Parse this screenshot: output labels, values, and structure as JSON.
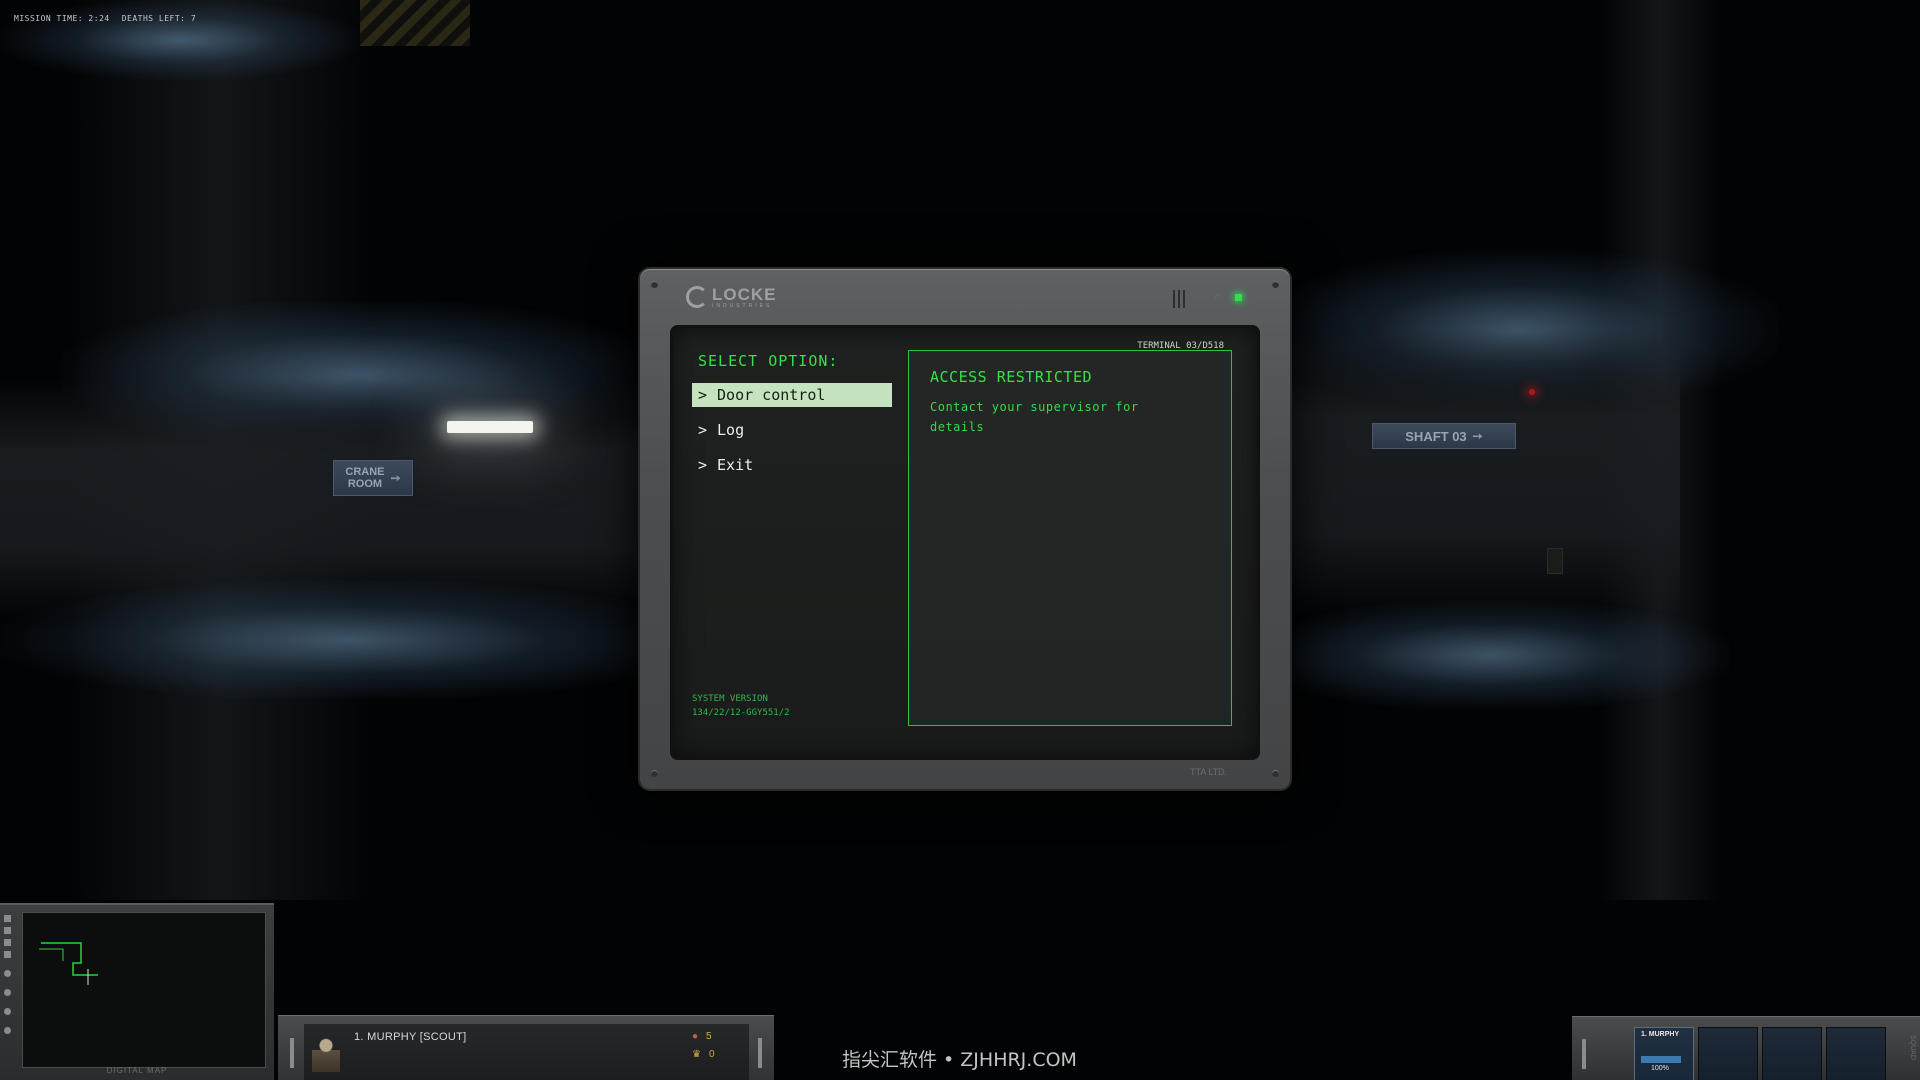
{
  "hud": {
    "mission_time": "MISSION TIME: 2:24",
    "deaths_left": "DEATHS LEFT: 7"
  },
  "environment": {
    "sign_crane_line1": "CRANE",
    "sign_crane_line2": "ROOM",
    "sign_shaft": "SHAFT 03"
  },
  "terminal": {
    "brand_name": "LOCKE",
    "brand_sub": "INDUSTRIES",
    "terminal_id": "TERMINAL 03/D518",
    "select_title": "SELECT OPTION:",
    "menu": [
      {
        "label": "Door control",
        "selected": true
      },
      {
        "label": "Log",
        "selected": false
      },
      {
        "label": "Exit",
        "selected": false
      }
    ],
    "system_version_label": "SYSTEM VERSION",
    "system_version_value": "134/22/12-GGY551/2",
    "panel_title": "ACCESS RESTRICTED",
    "panel_body": "Contact your supervisor for details",
    "footer": "TTA LTD.",
    "prompt_glyph": ">"
  },
  "minimap": {
    "label": "DIGITAL MAP"
  },
  "character": {
    "name": "1. MURPHY  [SCOUT]",
    "stat_kills": "5",
    "stat_rank": "0"
  },
  "squad": {
    "slot1_name": "1. MURPHY",
    "slot1_hp": "100%",
    "side_label": "SQUAD"
  },
  "watermark": "指尖汇软件 • ZJHHRJ.COM",
  "colors": {
    "terminal_green": "#36e048",
    "highlight": "#c6e3c0",
    "status_led": "#30e050"
  }
}
